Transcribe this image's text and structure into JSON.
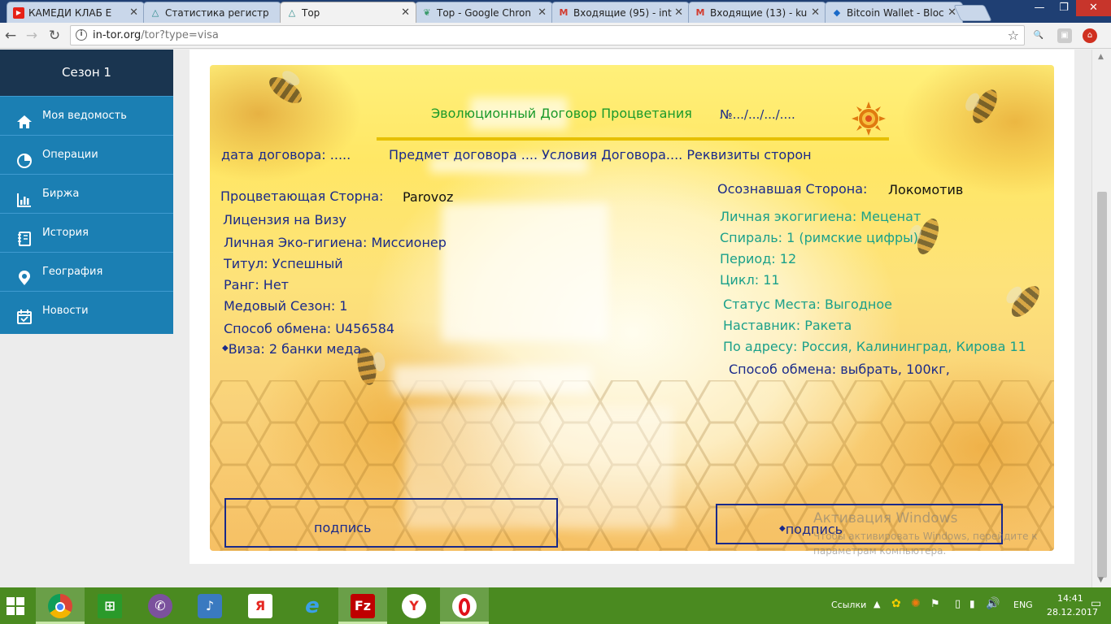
{
  "browser": {
    "tabs": [
      {
        "title": "КАМЕДИ КЛАБ Е",
        "icon": "youtube-icon",
        "active": false
      },
      {
        "title": "Статистика регистр",
        "icon": "triangle-logo-icon",
        "active": false
      },
      {
        "title": "Тор",
        "icon": "triangle-logo-icon",
        "active": true
      },
      {
        "title": "Тор - Google Chron",
        "icon": "leaf-icon",
        "active": false
      },
      {
        "title": "Входящие (95) - int",
        "icon": "gmail-icon",
        "active": false
      },
      {
        "title": "Входящие (13) - ku",
        "icon": "gmail-icon",
        "active": false
      },
      {
        "title": "Bitcoin Wallet - Bloc",
        "icon": "bitcoin-icon",
        "active": false
      }
    ],
    "url_host": "in-tor.org",
    "url_path": "/tor?type=visa"
  },
  "sidebar": {
    "header": "Сезон 1",
    "items": [
      {
        "label": "Моя ведомость",
        "icon": "home-icon"
      },
      {
        "label": "Операции",
        "icon": "pie-chart-icon"
      },
      {
        "label": "Биржа",
        "icon": "bar-chart-icon"
      },
      {
        "label": "История",
        "icon": "book-icon"
      },
      {
        "label": "География",
        "icon": "location-pin-icon"
      },
      {
        "label": "Новости",
        "icon": "calendar-icon"
      }
    ]
  },
  "contract": {
    "title": "Эволюционный Договор Процветания",
    "number": "№.../.../.../....",
    "headings": {
      "date": "дата договора: .....",
      "subject": "Предмет договора .... Условия Договора.... Реквизиты сторон"
    },
    "left": {
      "party_label": "Процветающая Сторна:",
      "party_value": "Parovoz",
      "license": "Лицензия на Визу",
      "eco": "Личная Эко-гигиена: Миссионер",
      "title": "Титул:   Успешный",
      "rank": "Ранг:   Нет",
      "season": "Медовый Сезон: 1",
      "exchange": "Способ обмена: U456584",
      "visa": "Виза: 2 банки меда"
    },
    "right": {
      "party_label": "Осознавшая Сторона:",
      "party_value": "Локомотив",
      "eco": "Личная экогигиена: Меценат",
      "spiral": "Спираль: 1 (римские цифры)",
      "period": "Период: 12",
      "cycle": "Цикл: 11",
      "status": "Статус Места:  Выгодное",
      "mentor": "Наставник: Ракета",
      "address": "По адресу: Россия, Калининград, Кирова 11",
      "exchange": "Способ обмена: выбрать, 100кг,"
    },
    "sign_left": "подпись",
    "sign_right": "подпись"
  },
  "watermark": {
    "title": "Активация Windows",
    "text": "Чтобы активировать Windows, перейдите к параметрам компьютера."
  },
  "taskbar": {
    "apps": [
      "windows-start-icon",
      "chrome-icon",
      "store-icon",
      "viber-icon",
      "speaker-app-icon",
      "yandex-icon",
      "internet-explorer-icon",
      "filezilla-icon",
      "yandex-browser-icon",
      "opera-icon"
    ],
    "links_label": "Ссылки",
    "lang": "ENG",
    "time": "14:41",
    "date": "28.12.2017"
  },
  "colors": {
    "sidebar": "#1b7fb3",
    "sidebar_header": "#1a3550",
    "title_green": "#1a9a2a",
    "navy_text": "#1a2a8a",
    "teal_text": "#1aa08a",
    "taskbar": "#4a8a20"
  }
}
